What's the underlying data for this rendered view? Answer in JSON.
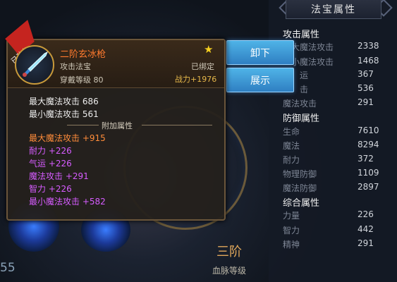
{
  "item": {
    "name": "二阶玄冰枪",
    "badge": "已装备",
    "type": "攻击法宝",
    "requirement": "穿戴等级 80",
    "bound": "已绑定",
    "power": "战力+1976",
    "base_stats": [
      "最大魔法攻击 686",
      "最小魔法攻击 561"
    ],
    "extra_header": "附加属性",
    "extra_stats": [
      {
        "text": "最大魔法攻击 +915",
        "color": "#ff8c3a"
      },
      {
        "text": "耐力 +226",
        "color": "#d65cff"
      },
      {
        "text": "气运 +226",
        "color": "#d65cff"
      },
      {
        "text": "魔法攻击 +291",
        "color": "#d65cff"
      },
      {
        "text": "智力 +226",
        "color": "#d65cff"
      },
      {
        "text": "最小魔法攻击 +582",
        "color": "#d65cff"
      }
    ]
  },
  "buttons": {
    "unequip": "卸下",
    "show": "展示"
  },
  "panel": {
    "title": "法宝属性",
    "attack_header": "攻击属性",
    "attack": [
      {
        "label": "大魔法攻击",
        "value": "2338"
      },
      {
        "label": "小魔法攻击",
        "value": "1468"
      },
      {
        "label": "运",
        "value": "367"
      },
      {
        "label": "击",
        "value": "536"
      },
      {
        "label": "魔法攻击",
        "value": "291"
      }
    ],
    "defense_header": "防御属性",
    "defense": [
      {
        "label": "生命",
        "value": "7610"
      },
      {
        "label": "魔法",
        "value": "8294"
      },
      {
        "label": "耐力",
        "value": "372"
      },
      {
        "label": "物理防御",
        "value": "1109"
      },
      {
        "label": "魔法防御",
        "value": "2897"
      }
    ],
    "overall_header": "综合属性",
    "overall": [
      {
        "label": "力量",
        "value": "226"
      },
      {
        "label": "智力",
        "value": "442"
      },
      {
        "label": "精神",
        "value": "291"
      }
    ]
  },
  "rank": {
    "value": "三阶",
    "label": "血脉等级"
  },
  "level_fragment": "55",
  "colors": {
    "accent_blue": "#3f9ad8",
    "name_orange": "#ff7a2e",
    "power_gold": "#e6b84a"
  }
}
